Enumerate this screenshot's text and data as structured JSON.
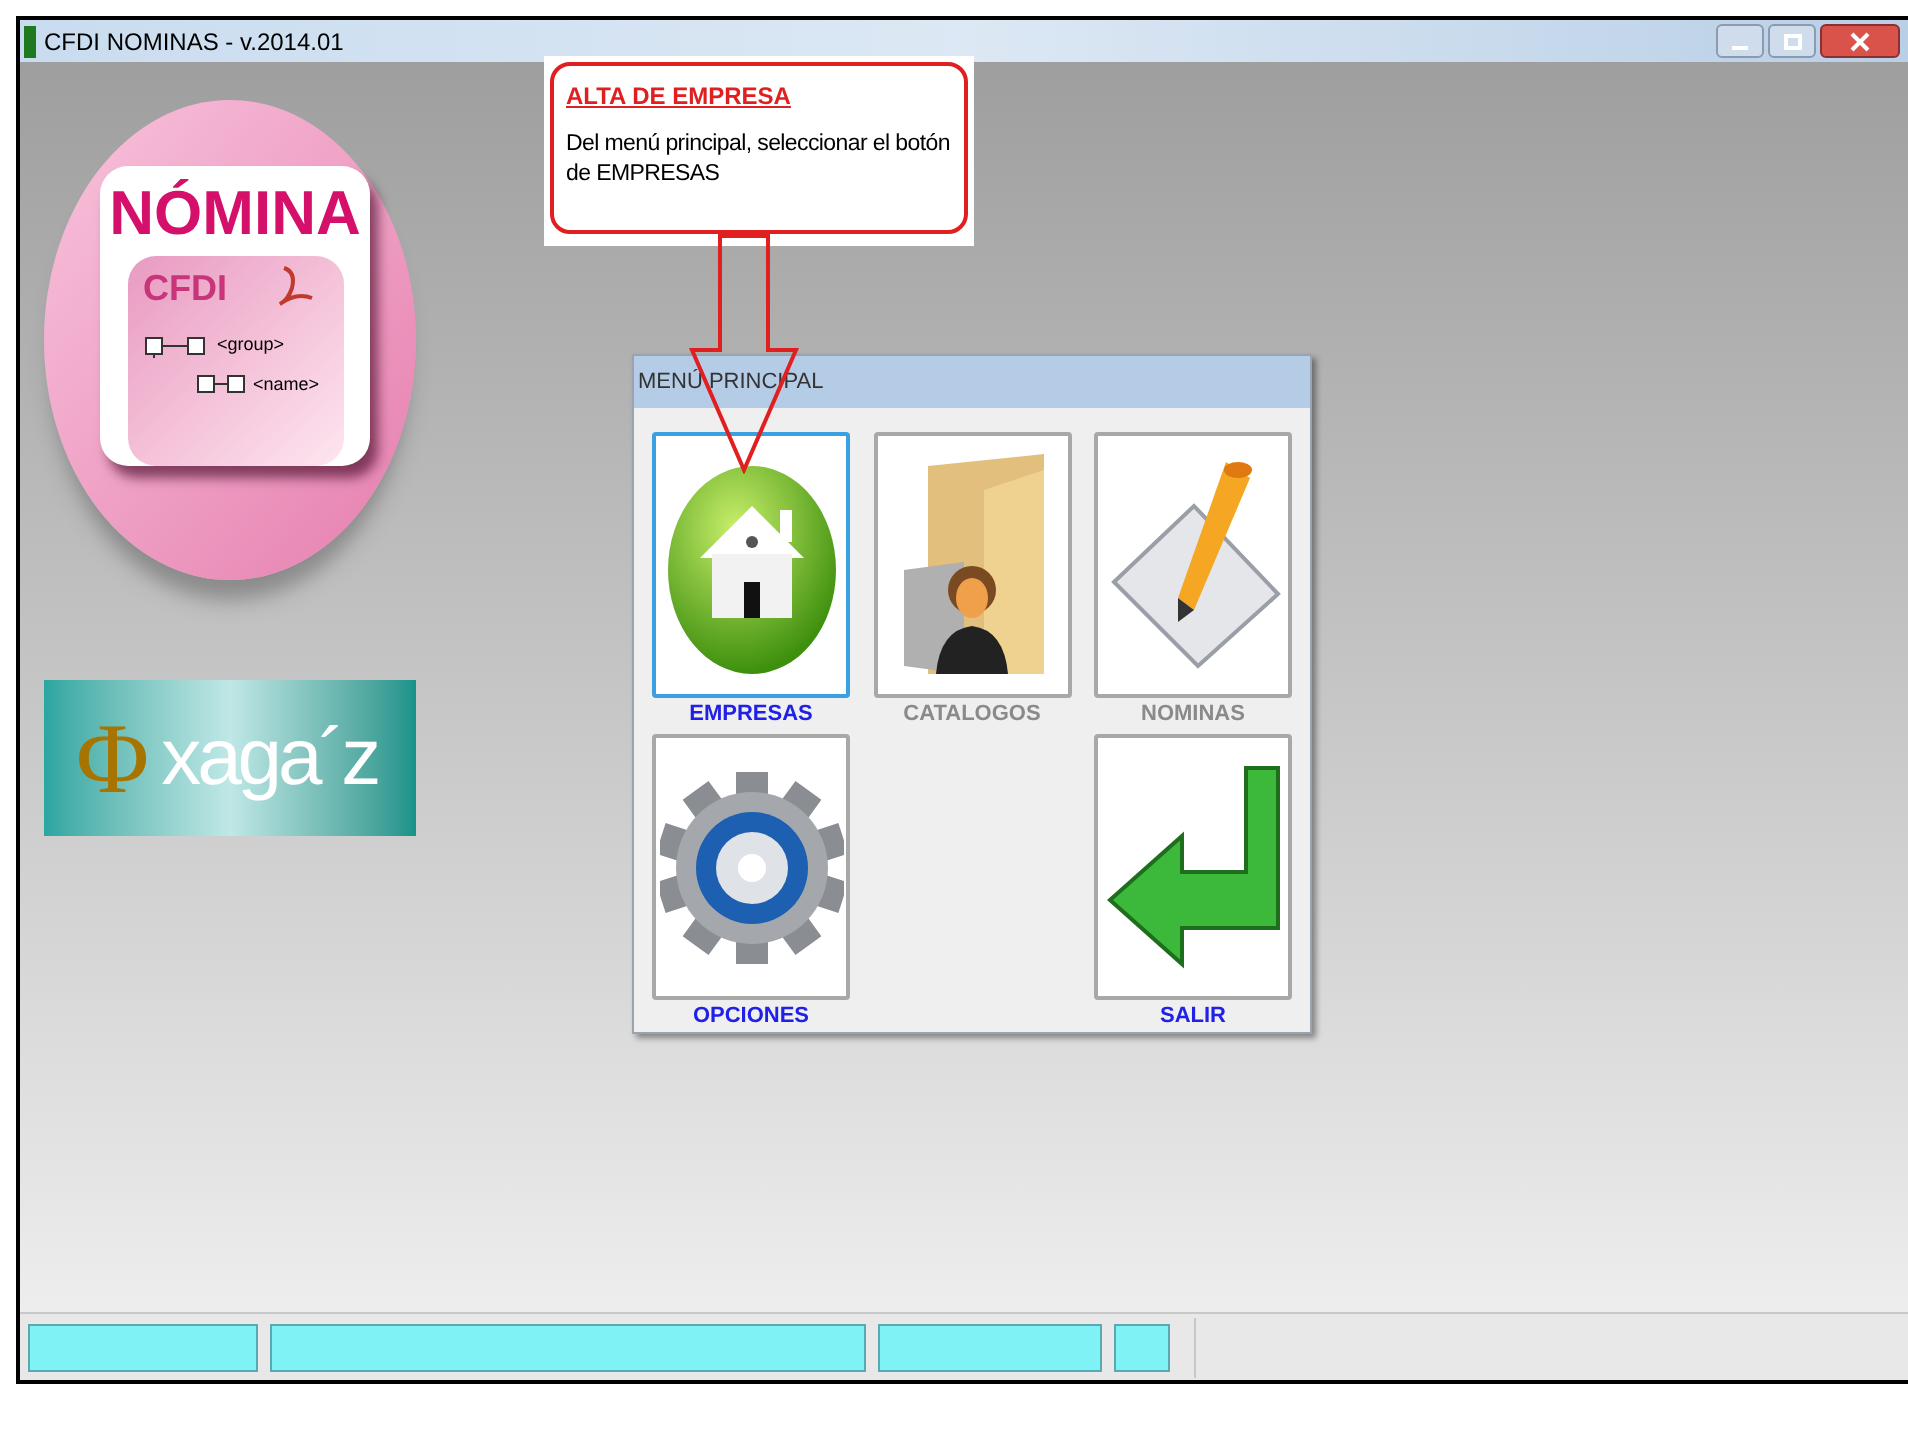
{
  "window": {
    "title": "CFDI NOMINAS - v.2014.01"
  },
  "logo": {
    "title": "NÓMINA",
    "subtitle": "CFDI",
    "tree": [
      "<group>",
      "<name>"
    ]
  },
  "brand": {
    "symbol": "Φ",
    "name": "xaga´z"
  },
  "callout": {
    "title": "ALTA DE EMPRESA",
    "text": "Del menú principal, seleccionar el botón de EMPRESAS"
  },
  "menu": {
    "title": "MENÚ PRINCIPAL",
    "rows": [
      {
        "buttons": [
          {
            "label": "EMPRESAS",
            "kind": "house",
            "disabled": false,
            "selected": true
          },
          {
            "label": "CATALOGOS",
            "kind": "folder",
            "disabled": true,
            "selected": false
          },
          {
            "label": "NOMINAS",
            "kind": "pencil",
            "disabled": true,
            "selected": false
          }
        ]
      },
      {
        "buttons": [
          {
            "label": "OPCIONES",
            "kind": "gear",
            "disabled": false,
            "selected": false
          },
          {
            "label": "SALIR",
            "kind": "exit",
            "disabled": false,
            "selected": false
          }
        ]
      }
    ]
  },
  "status_bar": {
    "panels": [
      {
        "kind": "panel"
      },
      {
        "kind": "panel"
      },
      {
        "kind": "panel"
      },
      {
        "kind": "panel"
      }
    ]
  }
}
